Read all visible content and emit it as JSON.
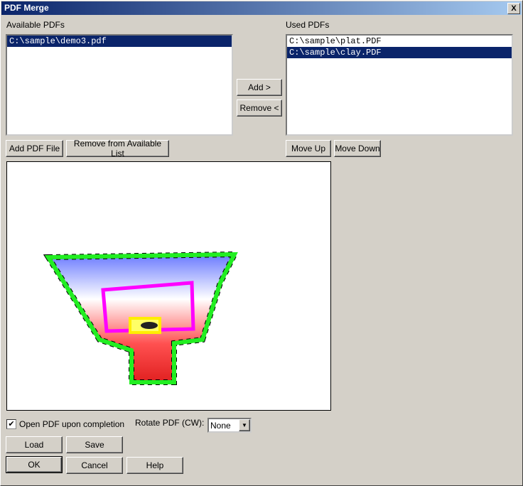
{
  "window": {
    "title": "PDF Merge",
    "close": "X"
  },
  "available": {
    "label": "Available PDFs",
    "items": [
      "C:\\sample\\demo3.pdf"
    ]
  },
  "used": {
    "label": "Used PDFs",
    "items": [
      "C:\\sample\\plat.PDF",
      "C:\\sample\\clay.PDF"
    ]
  },
  "buttons": {
    "add": "Add >",
    "remove": "Remove <",
    "add_pdf": "Add PDF File",
    "remove_available": "Remove from Available List",
    "move_up": "Move Up",
    "move_down": "Move Down",
    "load": "Load",
    "save": "Save",
    "ok": "OK",
    "cancel": "Cancel",
    "help": "Help"
  },
  "options": {
    "open_pdf_label": "Open PDF upon completion",
    "open_pdf_checked": true,
    "rotate_label": "Rotate PDF (CW):",
    "rotate_value": "None"
  },
  "icons": {
    "close": "close-icon",
    "checkbox": "check-icon",
    "dropdown": "chevron-down-icon"
  }
}
